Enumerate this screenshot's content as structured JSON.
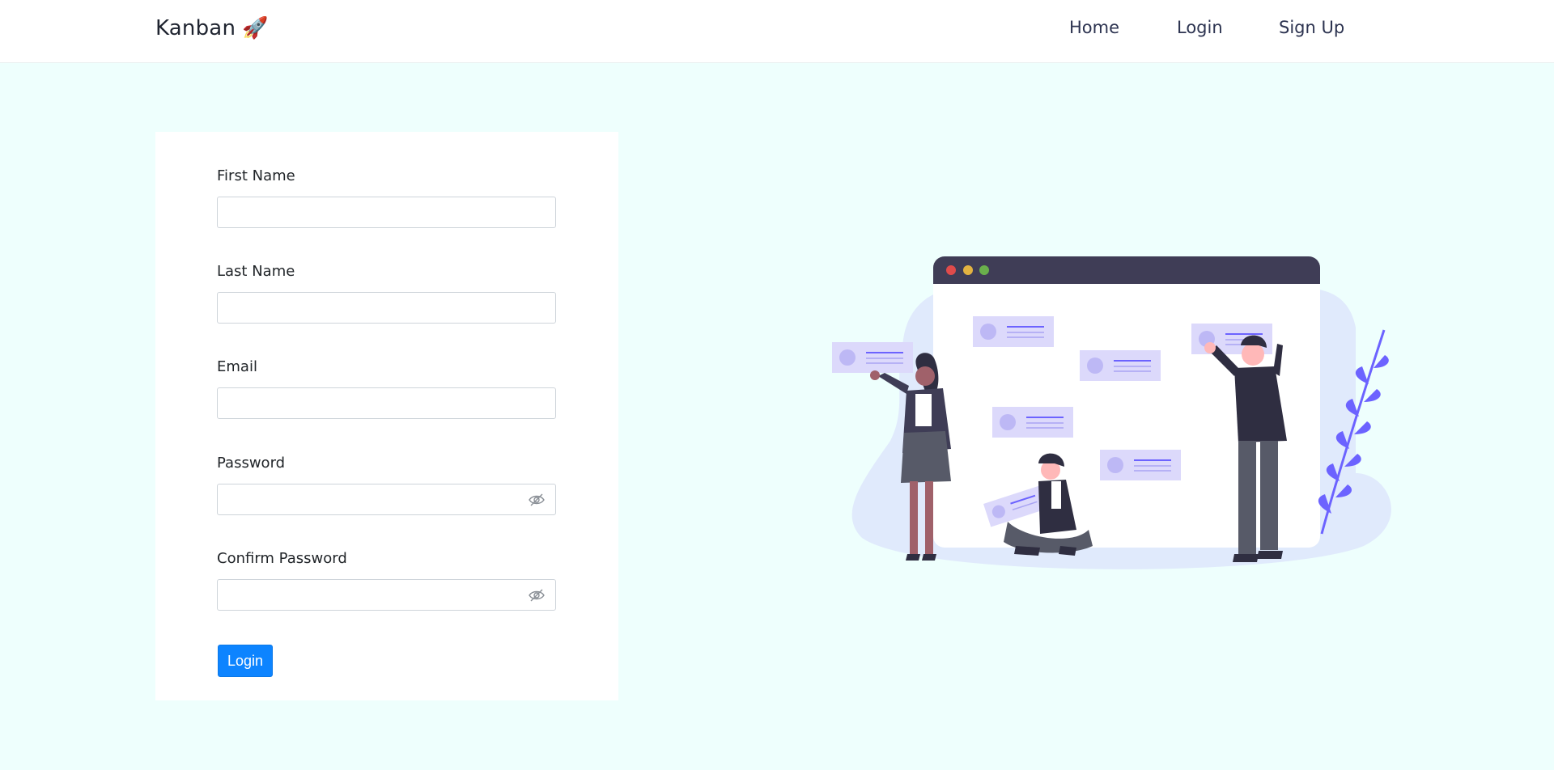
{
  "brand": {
    "name": "Kanban",
    "icon": "rocket-icon",
    "emoji": "🚀"
  },
  "nav": {
    "home": "Home",
    "login": "Login",
    "signup": "Sign Up"
  },
  "form": {
    "first_name_label": "First Name",
    "first_name_value": "",
    "last_name_label": "Last Name",
    "last_name_value": "",
    "email_label": "Email",
    "email_value": "",
    "password_label": "Password",
    "password_value": "",
    "confirm_password_label": "Confirm Password",
    "confirm_password_value": "",
    "submit_label": "Login",
    "password_toggle_icon": "eye-slash-icon"
  },
  "colors": {
    "background": "#eefffd",
    "primary_button": "#0d84ff",
    "illustration_accent": "#6c63ff",
    "window_bar": "#3f3d56"
  }
}
